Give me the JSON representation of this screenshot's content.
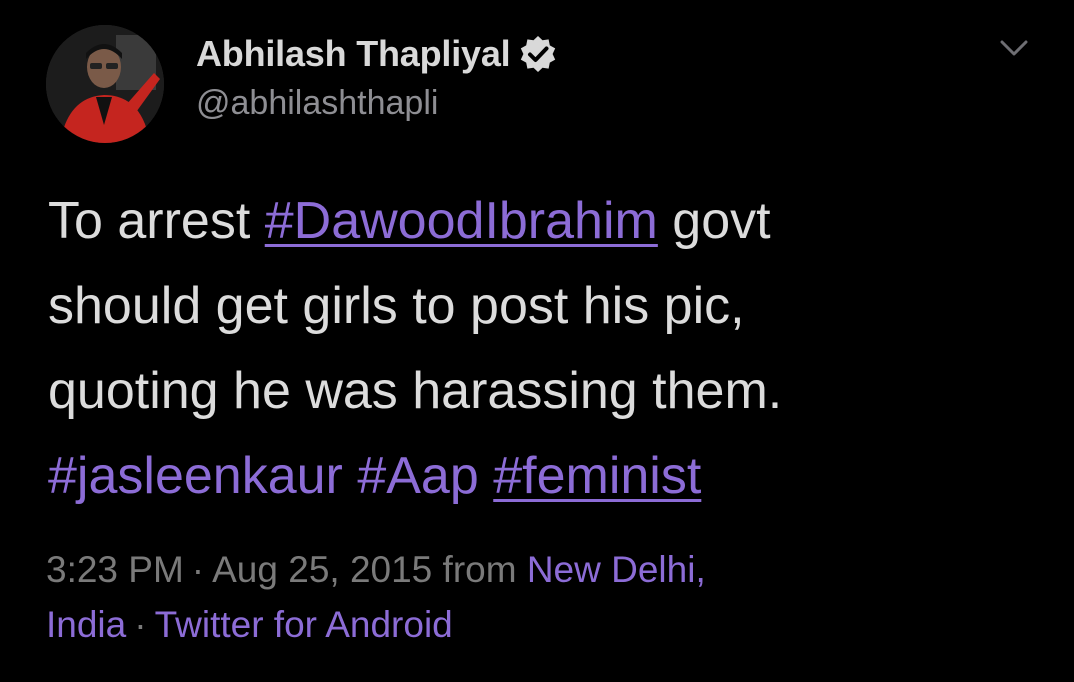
{
  "author": {
    "display_name": "Abhilash Thapliyal",
    "handle": "@abhilashthapli",
    "verified": true
  },
  "tweet": {
    "line1": {
      "pre": "To arrest ",
      "hashtag": "#DawoodIbrahim",
      "post": " govt"
    },
    "line2": "should get girls to post his pic,",
    "line3": "quoting he was harassing them.",
    "line4": {
      "tag1": "#jasleenkaur",
      "tag2": "#Aap",
      "tag3": "#feminist"
    }
  },
  "meta": {
    "time": "3:23 PM",
    "dot": "·",
    "date": "Aug 25, 2015",
    "from": "from",
    "location_part1": "New Delhi,",
    "location_part2": "India",
    "source": "Twitter for Android"
  },
  "icons": {
    "verified": "verified-badge-icon",
    "menu": "chevron-down-icon"
  },
  "colors": {
    "background": "#000000",
    "text": "#d9d9d9",
    "secondary": "#8e8e93",
    "link": "#8c6cd6"
  }
}
